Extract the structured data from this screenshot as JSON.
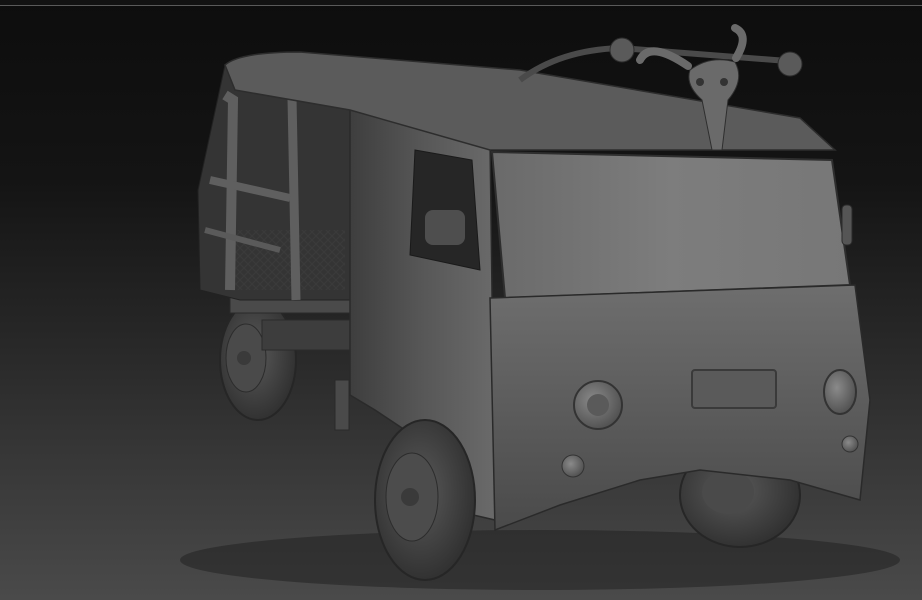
{
  "viewport": {
    "background_top": "#0d0d0d",
    "background_bottom": "#4a4a4a",
    "material_color": "#5c5c5c"
  },
  "subject": {
    "icon": "sculpted-offroad-van-icon",
    "ornament_icon": "ram-skull-icon"
  }
}
